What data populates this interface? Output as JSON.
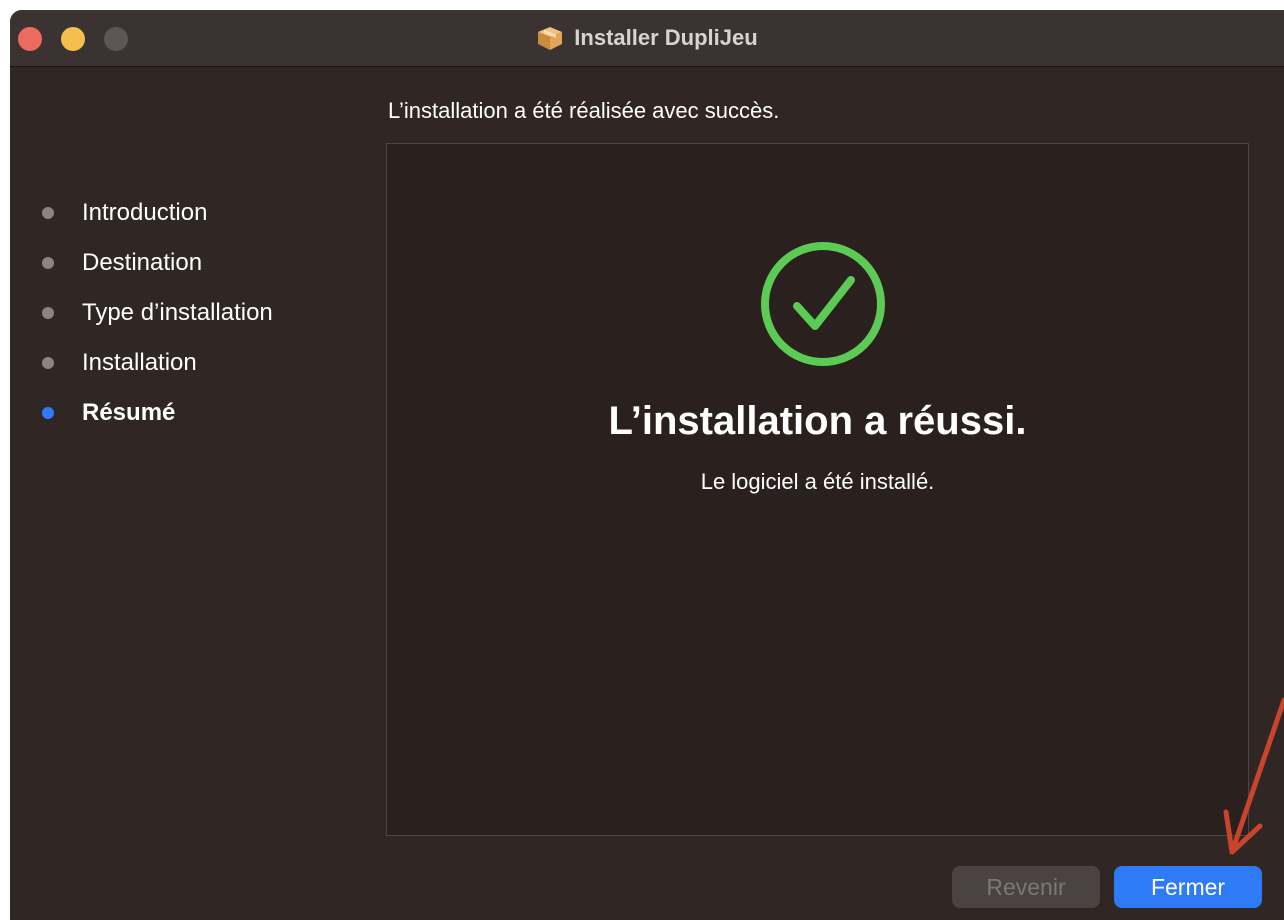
{
  "window": {
    "title": "Installer DupliJeu",
    "title_icon": "package-box-icon"
  },
  "heading": "L’installation a été réalisée avec succès.",
  "sidebar": {
    "steps": [
      {
        "label": "Introduction",
        "active": false
      },
      {
        "label": "Destination",
        "active": false
      },
      {
        "label": "Type d’installation",
        "active": false
      },
      {
        "label": "Installation",
        "active": false
      },
      {
        "label": "Résumé",
        "active": true
      }
    ]
  },
  "main": {
    "status_icon": "checkmark-circle-icon",
    "title": "L’installation a réussi.",
    "subtitle": "Le logiciel a été installé."
  },
  "buttons": {
    "back_label": "Revenir",
    "close_label": "Fermer"
  },
  "colors": {
    "accent": "#2f7bf5",
    "success": "#5ccb55",
    "annotation_arrow": "#c9442d"
  }
}
